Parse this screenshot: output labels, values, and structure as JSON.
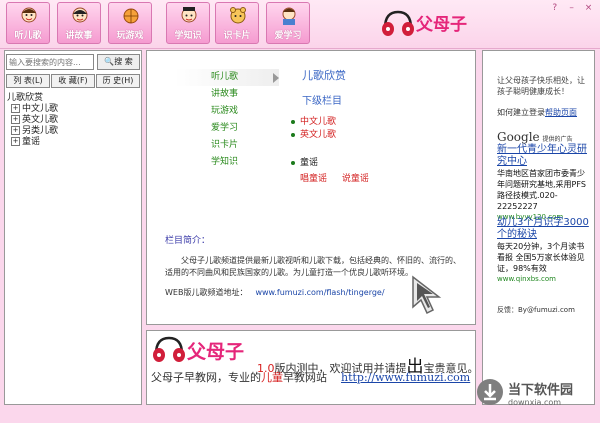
{
  "nav": {
    "buttons": [
      {
        "id": "listen",
        "label": "听儿歌"
      },
      {
        "id": "story",
        "label": "讲故事"
      },
      {
        "id": "play",
        "label": "玩游戏"
      },
      {
        "id": "learn",
        "label": "学知识"
      },
      {
        "id": "cards",
        "label": "识卡片"
      },
      {
        "id": "study",
        "label": "爱学习"
      }
    ]
  },
  "logo": {
    "text": "父母子"
  },
  "window_controls": {
    "help": "?",
    "minimize": "–",
    "close": "×"
  },
  "left_panel": {
    "search_placeholder": "输入要搜索的内容...",
    "search_button": "搜 索",
    "tabs": [
      "列 表(L)",
      "收 藏(F)",
      "历 史(H)"
    ],
    "tree": {
      "root": "儿歌欣赏",
      "children": [
        "中文儿歌",
        "英文儿歌",
        "另类儿歌",
        "童谣"
      ]
    }
  },
  "center": {
    "menu": [
      "听儿歌",
      "讲故事",
      "玩游戏",
      "爱学习",
      "识卡片",
      "学知识"
    ],
    "title": "儿歌欣赏",
    "subtitle": "下级栏目",
    "categories": {
      "chinese": "中文儿歌",
      "english": "英文儿歌",
      "rhyme": "童谣"
    },
    "subcategories": [
      "唱童谣",
      "说童谣"
    ],
    "intro_label": "栏目简介：",
    "intro_text": "父母子儿歌频道提供最新儿歌视听和儿歌下载，包括经典的、怀旧的、流行的、适用的不同曲风和民族国家的儿歌。为儿童打造一个优良儿歌听环境。",
    "weblink_label": "WEB版儿歌频道地址：",
    "weblink_url": "www.fumuzi.com/flash/tingerge/"
  },
  "right_panel": {
    "welcome": "让父母孩子快乐相处，让孩子聪明健康成长！",
    "howto": "如何建立登录",
    "help_link": "帮助页面",
    "google": "Google",
    "google_sub": "提供的广告",
    "ads": [
      {
        "title": "新一代青少年心灵研究中心",
        "body": "华南地区首家团市委青少年问题研究基地,采用PFS路径技模式.020-22252227",
        "url": "www.byyy120.com"
      },
      {
        "title": "幼儿3个月识字3000个的秘诀",
        "body": "每天20分钟，3个月读书看报 全国5万家长体验见证，98%有效",
        "url": "www.qinxbs.com"
      }
    ],
    "feedback": "反馈：By@fumuzi.com"
  },
  "banner": {
    "logo_text": "父母子",
    "version": "1.0",
    "notice": "版内测中，欢迎试用并请提",
    "notice_big": "出",
    "notice_end": "宝贵意见。",
    "slogan_a": "父母子早教网，专业的",
    "slogan_hl": "儿童",
    "slogan_b": "早教网站",
    "slogan_url": "http://www.fumuzi.com"
  },
  "watermark": {
    "title": "当下软件园",
    "domain": "downxia.com"
  }
}
